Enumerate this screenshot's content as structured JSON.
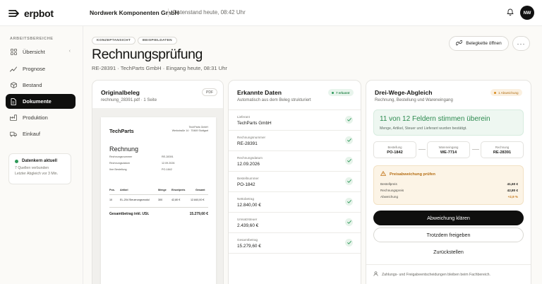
{
  "app": {
    "name": "erpbot"
  },
  "topbar": {
    "company": "Nordwerk Komponenten GmbH",
    "status": "Datenstand heute, 08:42 Uhr",
    "avatar_initials": "NW"
  },
  "sidebar": {
    "section_label": "ARBEITSBEREICHE",
    "items": [
      {
        "label": "Übersicht",
        "icon": "grid-icon"
      },
      {
        "label": "Prognose",
        "icon": "trend-icon"
      },
      {
        "label": "Bestand",
        "icon": "box-icon"
      },
      {
        "label": "Dokumente",
        "icon": "document-icon",
        "active": true
      },
      {
        "label": "Produktion",
        "icon": "factory-icon"
      },
      {
        "label": "Einkauf",
        "icon": "truck-icon"
      }
    ],
    "status_card": {
      "title": "Datenkern aktuell",
      "line1": "7 Quellen verbunden",
      "line2": "Letzter Abgleich vor 3 Min."
    }
  },
  "header": {
    "tags": [
      "KONZEPTANSICHT",
      "BEISPIELDATEN"
    ],
    "title": "Rechnungsprüfung",
    "subtitle": "RE-28391 · TechParts GmbH · Eingang heute, 08:31 Uhr",
    "open_chain_label": "Belegkette öffnen",
    "more_label": "···"
  },
  "original": {
    "title": "Originalbeleg",
    "file": "rechnung_28391.pdf · 1 Seite",
    "badge": "PDF",
    "doc": {
      "brand": "TechParts",
      "address_line1": "TechParts GmbH",
      "address_line2": "Werkstraße 14 · 70469 Stuttgart",
      "heading": "Rechnung",
      "meta": [
        {
          "label": "Rechnungsnummer",
          "value": "RE-28391"
        },
        {
          "label": "Rechnungsdatum",
          "value": "12.09.2026"
        },
        {
          "label": "Ihre Bestellung",
          "value": "PO-1842"
        }
      ],
      "columns": [
        "Pos.",
        "Artikel",
        "Menge",
        "Einzelpreis",
        "Gesamt"
      ],
      "row": [
        "10",
        "EL-204 Steuerungsmodul",
        "300",
        "42,80 €",
        "12.840,00 €"
      ],
      "total_label": "Gesamtbetrag inkl. USt.",
      "total_value": "15.279,60 €"
    }
  },
  "extracted": {
    "title": "Erkannte Daten",
    "subtitle": "Automatisch aus dem Beleg strukturiert",
    "badge": "7 erkannt",
    "fields": [
      {
        "label": "Lieferant",
        "value": "TechParts GmbH"
      },
      {
        "label": "Rechnungsnummer",
        "value": "RE-28391"
      },
      {
        "label": "Rechnungsdatum",
        "value": "12.09.2026"
      },
      {
        "label": "Bestellnummer",
        "value": "PO-1842"
      },
      {
        "label": "Nettobetrag",
        "value": "12.840,00 €"
      },
      {
        "label": "Umsatzsteuer",
        "value": "2.439,60 €"
      },
      {
        "label": "Gesamtbetrag",
        "value": "15.279,60 €"
      }
    ]
  },
  "threeway": {
    "title": "Drei-Wege-Abgleich",
    "subtitle": "Rechnung, Bestellung und Wareneingang",
    "badge": "1 Abweichung",
    "match_headline": "11 von 12 Feldern stimmen überein",
    "match_sub": "Menge, Artikel, Steuer und Lieferant wurden bestätigt.",
    "docs": [
      {
        "label": "Bestellung",
        "value": "PO-1842"
      },
      {
        "label": "Wareneingang",
        "value": "WE-7714"
      },
      {
        "label": "Rechnung",
        "value": "RE-28391"
      }
    ],
    "price_check": {
      "title": "Preisabweichung prüfen",
      "rows": [
        {
          "label": "Bestellpreis",
          "value": "41,60 €"
        },
        {
          "label": "Rechnungspreis",
          "value": "42,80 €"
        },
        {
          "label": "Abweichung",
          "value": "+2,9 %"
        }
      ]
    },
    "primary_action": "Abweichung klären",
    "secondary_action": "Trotzdem freigeben",
    "tertiary_action": "Zurückstellen",
    "footnote": "Zahlungs- und Freigabeentscheidungen bleiben beim Fachbereich."
  },
  "colors": {
    "accent_green": "#2c8a4f",
    "warning": "#b56d12",
    "primary_button": "#0f0f0e"
  }
}
